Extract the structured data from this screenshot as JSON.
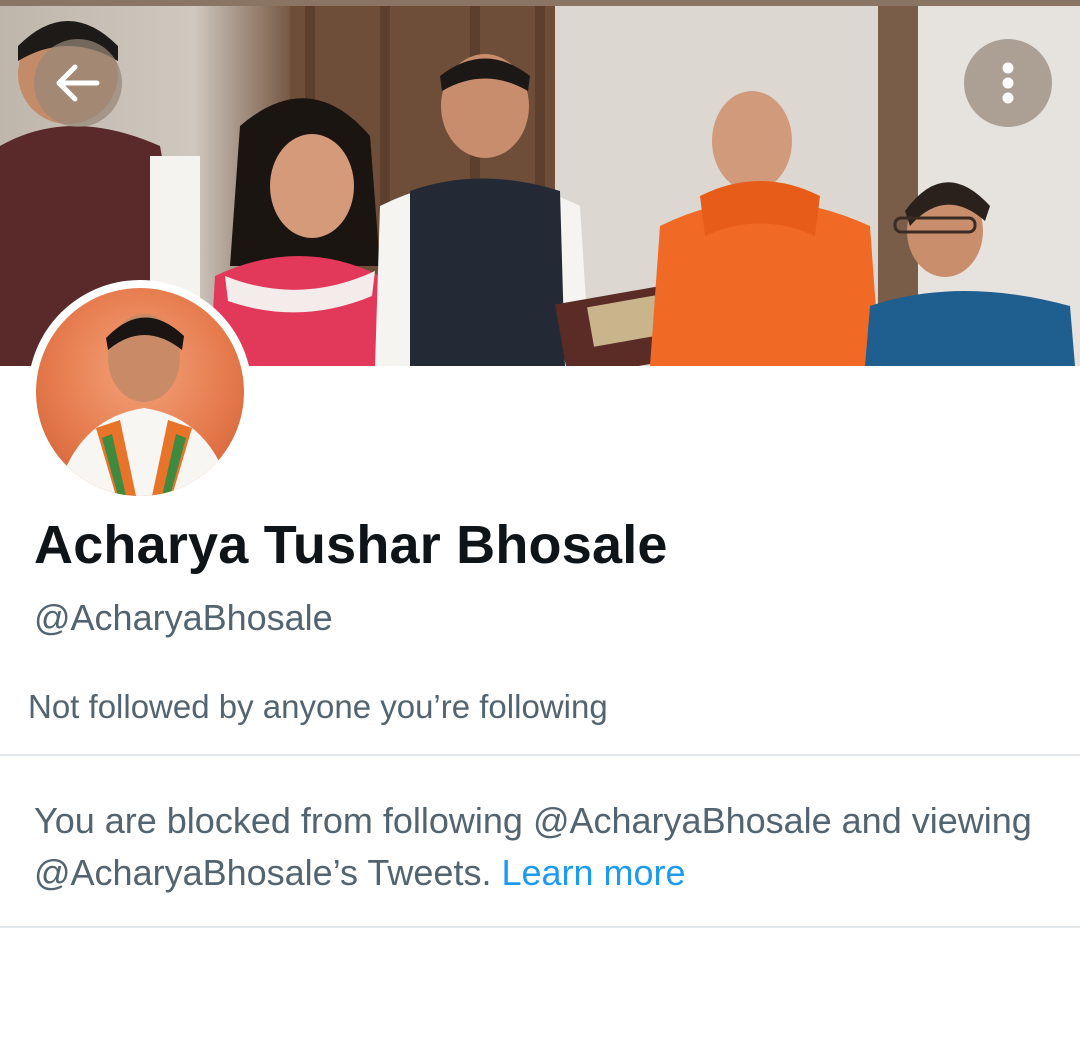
{
  "header": {
    "back_icon": "arrow-left-icon",
    "more_icon": "more-vertical-icon"
  },
  "profile": {
    "display_name": "Acharya Tushar Bhosale",
    "handle": "@AcharyaBhosale",
    "followed_by": "Not followed by anyone you’re following"
  },
  "notice": {
    "blocked_text": "You are blocked from following @AcharyaBhosale and viewing @AcharyaBhosale’s Tweets. ",
    "learn_more": "Learn more",
    "link_color": "#1d9bf0"
  },
  "colors": {
    "primary_text": "#0f1419",
    "secondary_text": "#536471",
    "divider": "#e1e6ea"
  }
}
